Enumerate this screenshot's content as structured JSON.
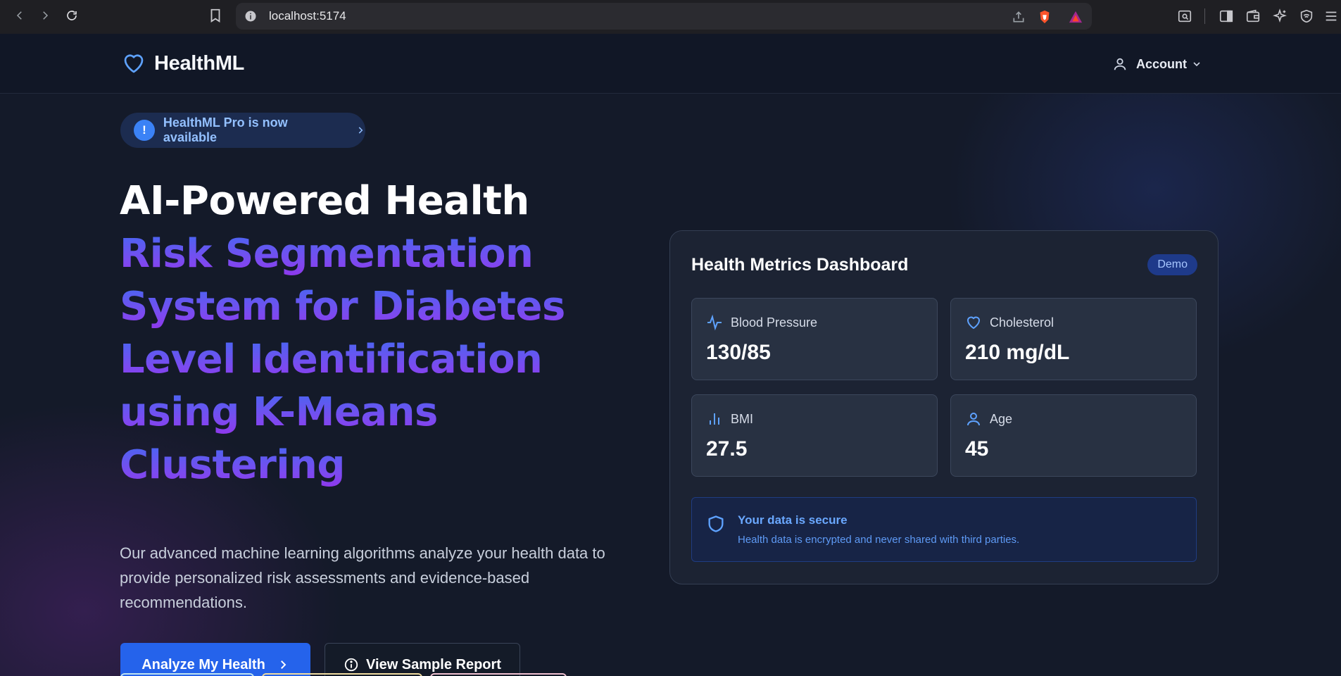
{
  "browser": {
    "url": "localhost:5174"
  },
  "nav": {
    "brand": "HealthML",
    "account_label": "Account"
  },
  "announcement": {
    "text": "HealthML Pro is now available"
  },
  "hero": {
    "title_line1": "AI-Powered Health",
    "title_gradient": [
      "Risk Segmentation",
      "System for Diabetes",
      "Level Identification",
      "using K-Means",
      "Clustering"
    ],
    "description": "Our advanced machine learning algorithms analyze your health data to provide personalized risk assessments and evidence-based recommendations.",
    "primary_button": "Analyze My Health",
    "secondary_button": "View Sample Report"
  },
  "dashboard": {
    "title": "Health Metrics Dashboard",
    "badge": "Demo",
    "metrics": [
      {
        "label": "Blood Pressure",
        "value": "130/85",
        "icon": "activity-icon"
      },
      {
        "label": "Cholesterol",
        "value": "210 mg/dL",
        "icon": "heart-icon"
      },
      {
        "label": "BMI",
        "value": "27.5",
        "icon": "bar-chart-icon"
      },
      {
        "label": "Age",
        "value": "45",
        "icon": "user-icon"
      }
    ],
    "secure": {
      "title": "Your data is secure",
      "text": "Health data is encrypted and never shared with third parties."
    }
  },
  "colors": {
    "accent": "#2563eb",
    "icon_blue": "#5ea2ff",
    "page_bg": "#141a29",
    "gradient_start": "#3b6cf6",
    "gradient_end": "#9333ea"
  }
}
